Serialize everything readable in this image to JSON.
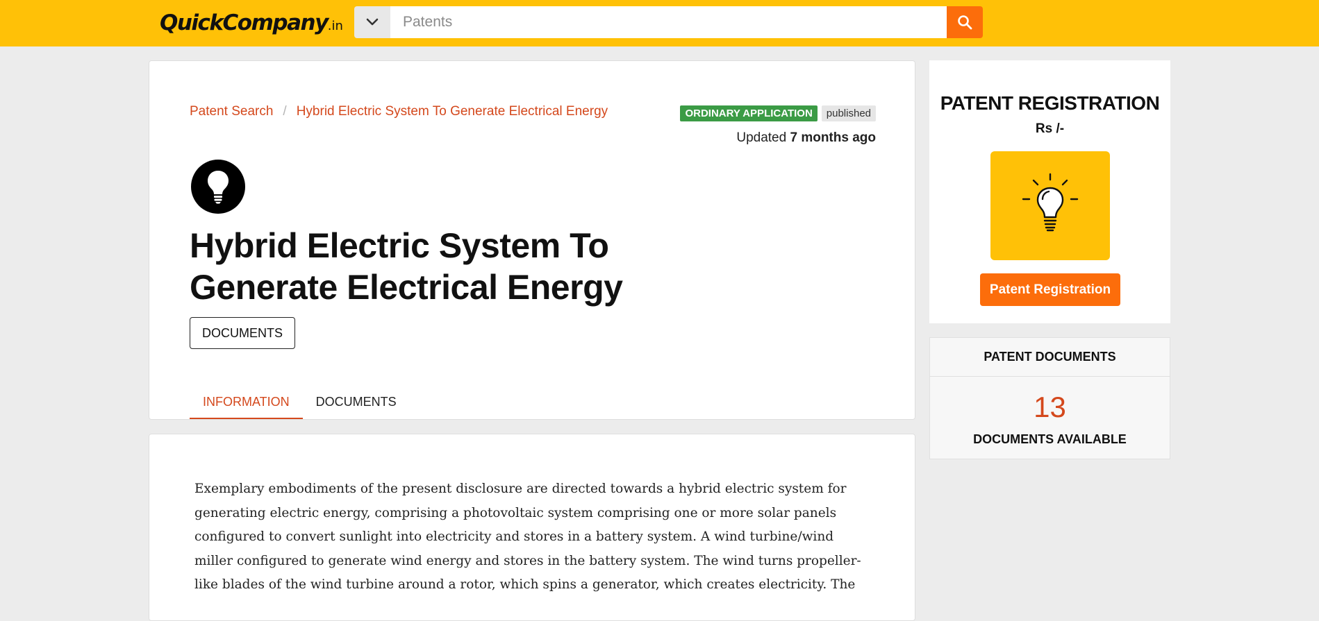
{
  "header": {
    "logo_text": "QuickCompany",
    "logo_tld": ".in",
    "search_placeholder": "Patents",
    "brand_color": "#ffc107",
    "accent_color": "#fc6d0b"
  },
  "breadcrumb": {
    "root": "Patent Search",
    "separator": "/",
    "current": "Hybrid Electric System To Generate Electrical Energy"
  },
  "status": {
    "type_badge": "ORDINARY APPLICATION",
    "state_badge": "published",
    "updated_prefix": "Updated",
    "updated_value": "7 months ago"
  },
  "patent": {
    "title": "Hybrid Electric System To Generate Electrical Energy",
    "documents_button": "DOCUMENTS",
    "icon": "lightbulb-icon"
  },
  "tabs": [
    {
      "label": "INFORMATION",
      "active": true
    },
    {
      "label": "DOCUMENTS",
      "active": false
    }
  ],
  "description": "Exemplary embodiments of the present disclosure are directed towards a hybrid electric system for generating electric energy, comprising a photovoltaic system comprising one or more solar panels configured to convert sunlight into electricity and stores in a battery system. A wind turbine/wind miller configured to generate wind energy and stores in the battery system. The wind turns propeller-like blades of the wind turbine around a rotor, which spins a generator, which creates electricity. The",
  "sidebar": {
    "registration_title": "PATENT REGISTRATION",
    "registration_price": "Rs /-",
    "registration_button": "Patent Registration",
    "documents_header": "PATENT DOCUMENTS",
    "documents_count": "13",
    "documents_label": "DOCUMENTS AVAILABLE"
  }
}
